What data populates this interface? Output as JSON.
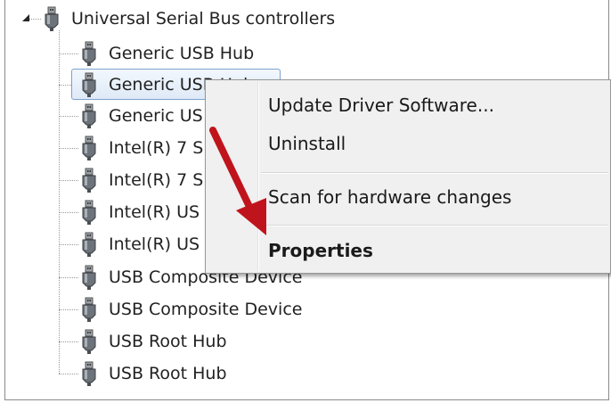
{
  "tree": {
    "category": {
      "label": "Universal Serial Bus controllers",
      "icon": "usb-plug-icon",
      "expanded": true
    },
    "devices": [
      {
        "label": "Generic USB Hub",
        "icon": "usb-plug-icon"
      },
      {
        "label": "Generic USB Hub",
        "icon": "usb-plug-icon",
        "selected": true
      },
      {
        "label": "Generic US",
        "icon": "usb-plug-icon"
      },
      {
        "label": "Intel(R) 7 S",
        "icon": "usb-plug-icon"
      },
      {
        "label": "Intel(R) 7 S",
        "icon": "usb-plug-icon"
      },
      {
        "label": "Intel(R) US",
        "icon": "usb-plug-icon"
      },
      {
        "label": "Intel(R) US",
        "icon": "usb-plug-icon"
      },
      {
        "label": "USB Composite Device",
        "icon": "usb-plug-icon"
      },
      {
        "label": "USB Composite Device",
        "icon": "usb-plug-icon"
      },
      {
        "label": "USB Root Hub",
        "icon": "usb-plug-icon"
      },
      {
        "label": "USB Root Hub",
        "icon": "usb-plug-icon"
      }
    ]
  },
  "context_menu": {
    "items": [
      {
        "label": "Update Driver Software..."
      },
      {
        "label": "Uninstall"
      },
      {
        "label": "Scan for hardware changes"
      },
      {
        "label": "Properties",
        "default": true
      }
    ]
  },
  "annotation": {
    "arrow_color": "#c0141c",
    "icon": "red-arrow-icon"
  },
  "colors": {
    "selection_border": "#7da2ce",
    "menu_background": "#f0f0f0"
  }
}
